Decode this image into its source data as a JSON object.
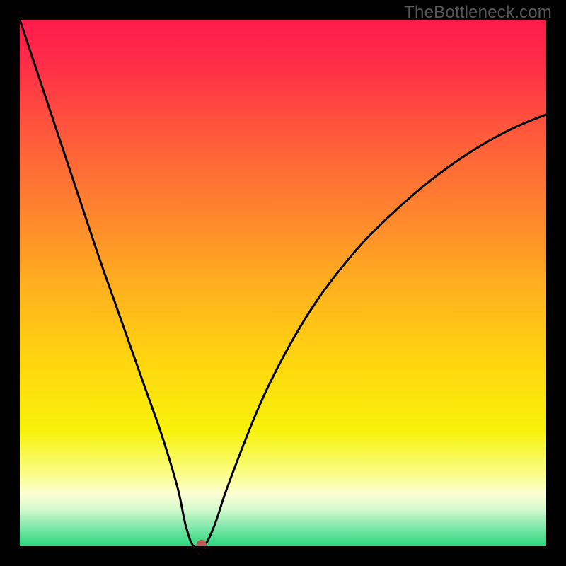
{
  "watermark": "TheBottleneck.com",
  "chart_data": {
    "type": "line",
    "title": "",
    "xlabel": "",
    "ylabel": "",
    "xlim": [
      0,
      100
    ],
    "ylim": [
      0,
      100
    ],
    "grid": false,
    "legend": false,
    "curve": {
      "name": "bottleneck-curve",
      "x": [
        0.0,
        3.0,
        6.0,
        9.0,
        12.0,
        15.0,
        18.0,
        21.0,
        24.0,
        27.0,
        30.0,
        31.5,
        33.0,
        35.0,
        37.0,
        39.0,
        42.0,
        45.0,
        48.0,
        52.0,
        56.0,
        60.0,
        65.0,
        70.0,
        75.0,
        80.0,
        85.0,
        90.0,
        95.0,
        100.0
      ],
      "y": [
        100.0,
        91.0,
        82.0,
        73.0,
        64.0,
        55.0,
        46.5,
        38.0,
        29.5,
        21.0,
        11.0,
        4.0,
        0.0,
        0.0,
        4.0,
        10.0,
        18.0,
        25.5,
        32.0,
        39.5,
        46.0,
        51.5,
        57.5,
        62.5,
        67.0,
        71.0,
        74.5,
        77.5,
        80.0,
        82.0
      ]
    },
    "marker": {
      "name": "optimal-point",
      "x": 34.5,
      "y": 0.0,
      "color": "#bb5a54",
      "radius_px": 7
    },
    "background_gradient": {
      "stops": [
        {
          "offset": 0.0,
          "color": "#ff1a4d"
        },
        {
          "offset": 0.1,
          "color": "#ff3247"
        },
        {
          "offset": 0.22,
          "color": "#ff5a3b"
        },
        {
          "offset": 0.35,
          "color": "#ff8030"
        },
        {
          "offset": 0.5,
          "color": "#ffae1f"
        },
        {
          "offset": 0.65,
          "color": "#ffd60f"
        },
        {
          "offset": 0.78,
          "color": "#f7f20a"
        },
        {
          "offset": 0.86,
          "color": "#fafd82"
        },
        {
          "offset": 0.9,
          "color": "#fcfed2"
        },
        {
          "offset": 0.93,
          "color": "#d4f9cf"
        },
        {
          "offset": 0.96,
          "color": "#8ae9af"
        },
        {
          "offset": 1.0,
          "color": "#28d67e"
        }
      ]
    }
  }
}
